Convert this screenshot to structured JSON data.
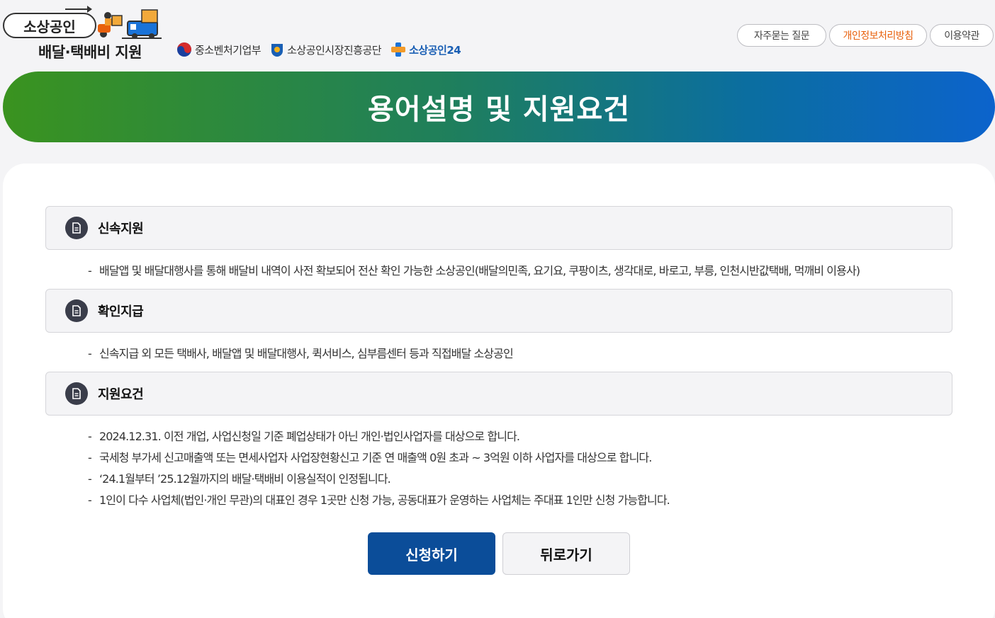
{
  "header": {
    "logo": {
      "title": "소상공인",
      "subtitle": "배달·택배비 지원"
    },
    "orgs": [
      {
        "name": "중소벤처기업부",
        "icon": "taegeuk-icon"
      },
      {
        "name": "소상공인시장진흥공단",
        "icon": "semas-logo-icon"
      },
      {
        "name": "소상공인24",
        "icon": "plus-logo-icon"
      }
    ],
    "links": [
      {
        "label": "자주묻는 질문"
      },
      {
        "label": "개인정보처리방침",
        "color": "#e8600c"
      },
      {
        "label": "이용약관"
      }
    ]
  },
  "banner": {
    "title": "용어설명 및 지원요건"
  },
  "sections": [
    {
      "title": "신속지원",
      "icon": "document-icon",
      "items": [
        "배달앱 및 배달대행사를 통해 배달비 내역이 사전 확보되어 전산 확인 가능한 소상공인(배달의민족, 요기요, 쿠팡이츠, 생각대로, 바로고, 부릉, 인천시반값택배, 먹깨비 이용사)"
      ]
    },
    {
      "title": "확인지급",
      "icon": "document-icon",
      "items": [
        "신속지급 외 모든 택배사, 배달앱 및 배달대행사, 퀵서비스, 심부름센터 등과 직접배달 소상공인"
      ]
    },
    {
      "title": "지원요건",
      "icon": "document-icon",
      "items": [
        "2024.12.31. 이전 개업, 사업신청일 기준 폐업상태가 아닌 개인·법인사업자를 대상으로 합니다.",
        "국세청 부가세 신고매출액 또는 면세사업자 사업장현황신고 기준 연 매출액 0원 초과 ~ 3억원 이하 사업자를 대상으로 합니다.",
        "‘24.1월부터 ’25.12월까지의 배달·택배비 이용실적이 인정됩니다.",
        "1인이 다수 사업체(법인·개인 무관)의 대표인 경우 1곳만 신청 가능, 공동대표가 운영하는 사업체는 주대표 1인만 신청 가능합니다."
      ]
    }
  ],
  "actions": {
    "apply": "신청하기",
    "back": "뒤로가기"
  },
  "colors": {
    "primary": "#0b4d99",
    "accent": "#e8600c",
    "banner_start": "#3a931f",
    "banner_end": "#0c63cc"
  }
}
